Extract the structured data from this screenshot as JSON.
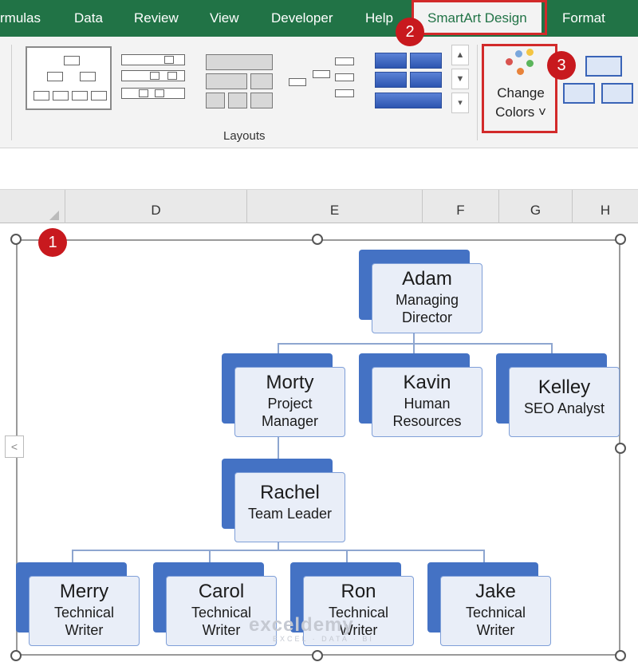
{
  "ribbon_tabs": [
    {
      "label": "rmulas"
    },
    {
      "label": "Data"
    },
    {
      "label": "Review"
    },
    {
      "label": "View"
    },
    {
      "label": "Developer"
    },
    {
      "label": "Help"
    },
    {
      "label": "SmartArt Design"
    },
    {
      "label": "Format"
    }
  ],
  "badges": [
    "1",
    "2",
    "3"
  ],
  "layouts_group": {
    "label": "Layouts"
  },
  "change_colors": {
    "line1": "Change",
    "line2": "Colors ˅"
  },
  "columns": [
    "D",
    "E",
    "F",
    "G",
    "H"
  ],
  "org_chart": {
    "nodes": [
      {
        "name": "Adam",
        "role1": "Managing",
        "role2": "Director"
      },
      {
        "name": "Morty",
        "role1": "Project",
        "role2": "Manager"
      },
      {
        "name": "Kavin",
        "role1": "Human",
        "role2": "Resources"
      },
      {
        "name": "Kelley",
        "role1": "SEO Analyst",
        "role2": ""
      },
      {
        "name": "Rachel",
        "role1": "Team Leader",
        "role2": ""
      },
      {
        "name": "Merry",
        "role1": "Technical",
        "role2": "Writer"
      },
      {
        "name": "Carol",
        "role1": "Technical",
        "role2": "Writer"
      },
      {
        "name": "Ron",
        "role1": "Technical",
        "role2": "Writer"
      },
      {
        "name": "Jake",
        "role1": "Technical",
        "role2": "Writer"
      }
    ]
  },
  "watermark": {
    "brand": "exceldemy",
    "tagline": "EXCEL · DATA · BI"
  },
  "colors": {
    "excel_green": "#217346",
    "badge_red": "#c8191e",
    "node_blue": "#4472c4",
    "node_fill": "#e9eef8"
  }
}
